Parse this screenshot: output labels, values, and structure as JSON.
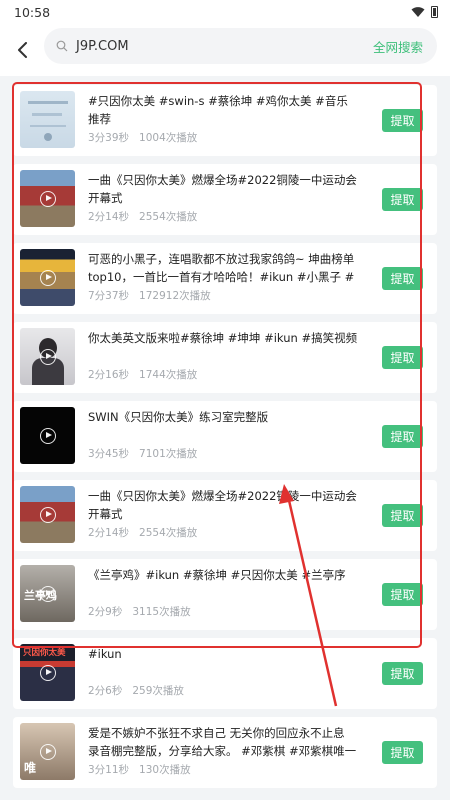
{
  "status": {
    "time": "10:58"
  },
  "search": {
    "query": "J9P.COM",
    "button": "全网搜索"
  },
  "extract_label": "提取",
  "videos": [
    {
      "title": "#只因你太美 #swin-s #蔡徐坤 #鸡你太美 #音乐推荐",
      "duration": "3分39秒",
      "plays": "1004次播放",
      "thumb": "t1"
    },
    {
      "title": "一曲《只因你太美》燃爆全场#2022铜陵一中运动会开幕式",
      "duration": "2分14秒",
      "plays": "2554次播放",
      "thumb": "t2"
    },
    {
      "title": "可恶的小黑子，连唱歌都不放过我家鸽鸽~ 坤曲榜单top10，一首比一首有才哈哈哈！#ikun #小黑子 #搞笑…",
      "duration": "7分37秒",
      "plays": "172912次播放",
      "thumb": "t3"
    },
    {
      "title": "你太美英文版来啦#蔡徐坤 #坤坤 #ikun #搞笑视频",
      "duration": "2分16秒",
      "plays": "1744次播放",
      "thumb": "t4"
    },
    {
      "title": "SWIN《只因你太美》练习室完整版",
      "duration": "3分45秒",
      "plays": "7101次播放",
      "thumb": "t5"
    },
    {
      "title": "一曲《只因你太美》燃爆全场#2022铜陵一中运动会开幕式",
      "duration": "2分14秒",
      "plays": "2554次播放",
      "thumb": "t2"
    },
    {
      "title": "《兰亭鸡》#ikun #蔡徐坤 #只因你太美 #兰亭序",
      "duration": "2分9秒",
      "plays": "3115次播放",
      "thumb": "t7",
      "thumb_text": "兰亭鸡"
    },
    {
      "title": "#ikun",
      "duration": "2分6秒",
      "plays": "259次播放",
      "thumb": "t8",
      "thumb_text": "只因你太美"
    },
    {
      "title": "爱是不嫉妒不张狂不求自己 无关你的回应永不止息 录音棚完整版，分享给大家。 #邓紫棋 #邓紫棋唯一 #唯一…",
      "duration": "3分11秒",
      "plays": "130次播放",
      "thumb": "t9",
      "thumb_text": "唯"
    }
  ]
}
